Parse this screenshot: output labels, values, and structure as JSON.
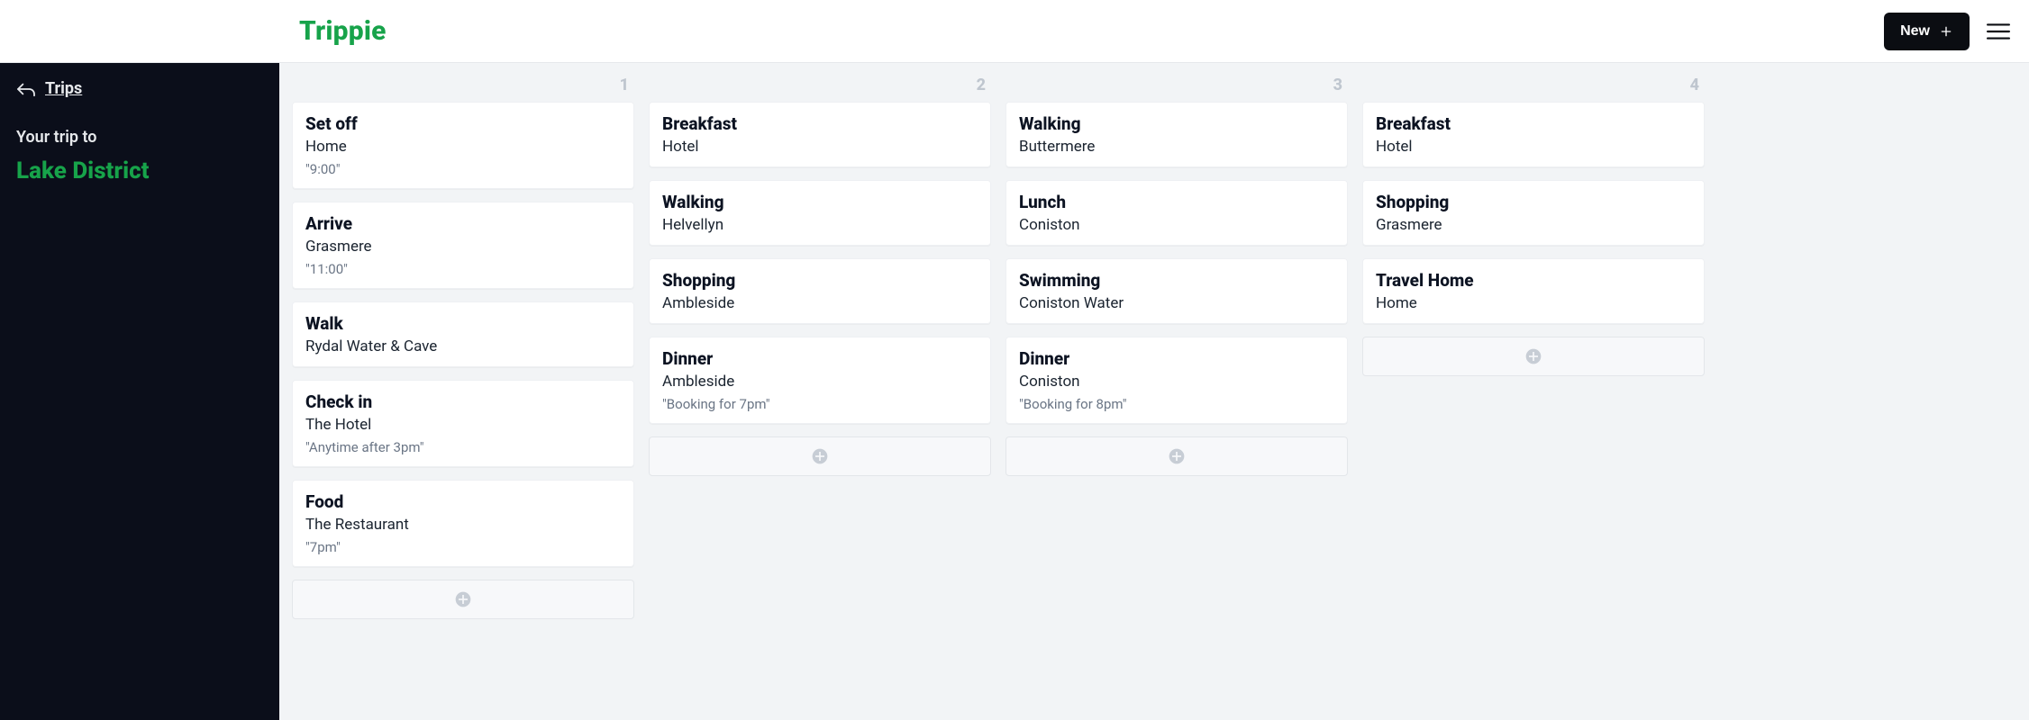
{
  "header": {
    "logo": "Trippie",
    "new_label": "New"
  },
  "sidebar": {
    "back_label": "Trips",
    "your_trip_to": "Your trip to",
    "trip_name": "Lake District"
  },
  "board": {
    "columns": [
      {
        "index": "1",
        "cards": [
          {
            "title": "Set off",
            "sub": "Home",
            "note": "\"9:00\""
          },
          {
            "title": "Arrive",
            "sub": "Grasmere",
            "note": "\"11:00\""
          },
          {
            "title": "Walk",
            "sub": "Rydal Water & Cave"
          },
          {
            "title": "Check in",
            "sub": "The Hotel",
            "note": "\"Anytime after 3pm\""
          },
          {
            "title": "Food",
            "sub": "The Restaurant",
            "note": "\"7pm\""
          }
        ]
      },
      {
        "index": "2",
        "cards": [
          {
            "title": "Breakfast",
            "sub": "Hotel"
          },
          {
            "title": "Walking",
            "sub": "Helvellyn"
          },
          {
            "title": "Shopping",
            "sub": "Ambleside"
          },
          {
            "title": "Dinner",
            "sub": "Ambleside",
            "note": "\"Booking for 7pm\""
          }
        ]
      },
      {
        "index": "3",
        "cards": [
          {
            "title": "Walking",
            "sub": "Buttermere"
          },
          {
            "title": "Lunch",
            "sub": "Coniston"
          },
          {
            "title": "Swimming",
            "sub": "Coniston Water"
          },
          {
            "title": "Dinner",
            "sub": "Coniston",
            "note": "\"Booking for 8pm\""
          }
        ]
      },
      {
        "index": "4",
        "cards": [
          {
            "title": "Breakfast",
            "sub": "Hotel"
          },
          {
            "title": "Shopping",
            "sub": "Grasmere"
          },
          {
            "title": "Travel Home",
            "sub": "Home"
          }
        ]
      }
    ]
  }
}
